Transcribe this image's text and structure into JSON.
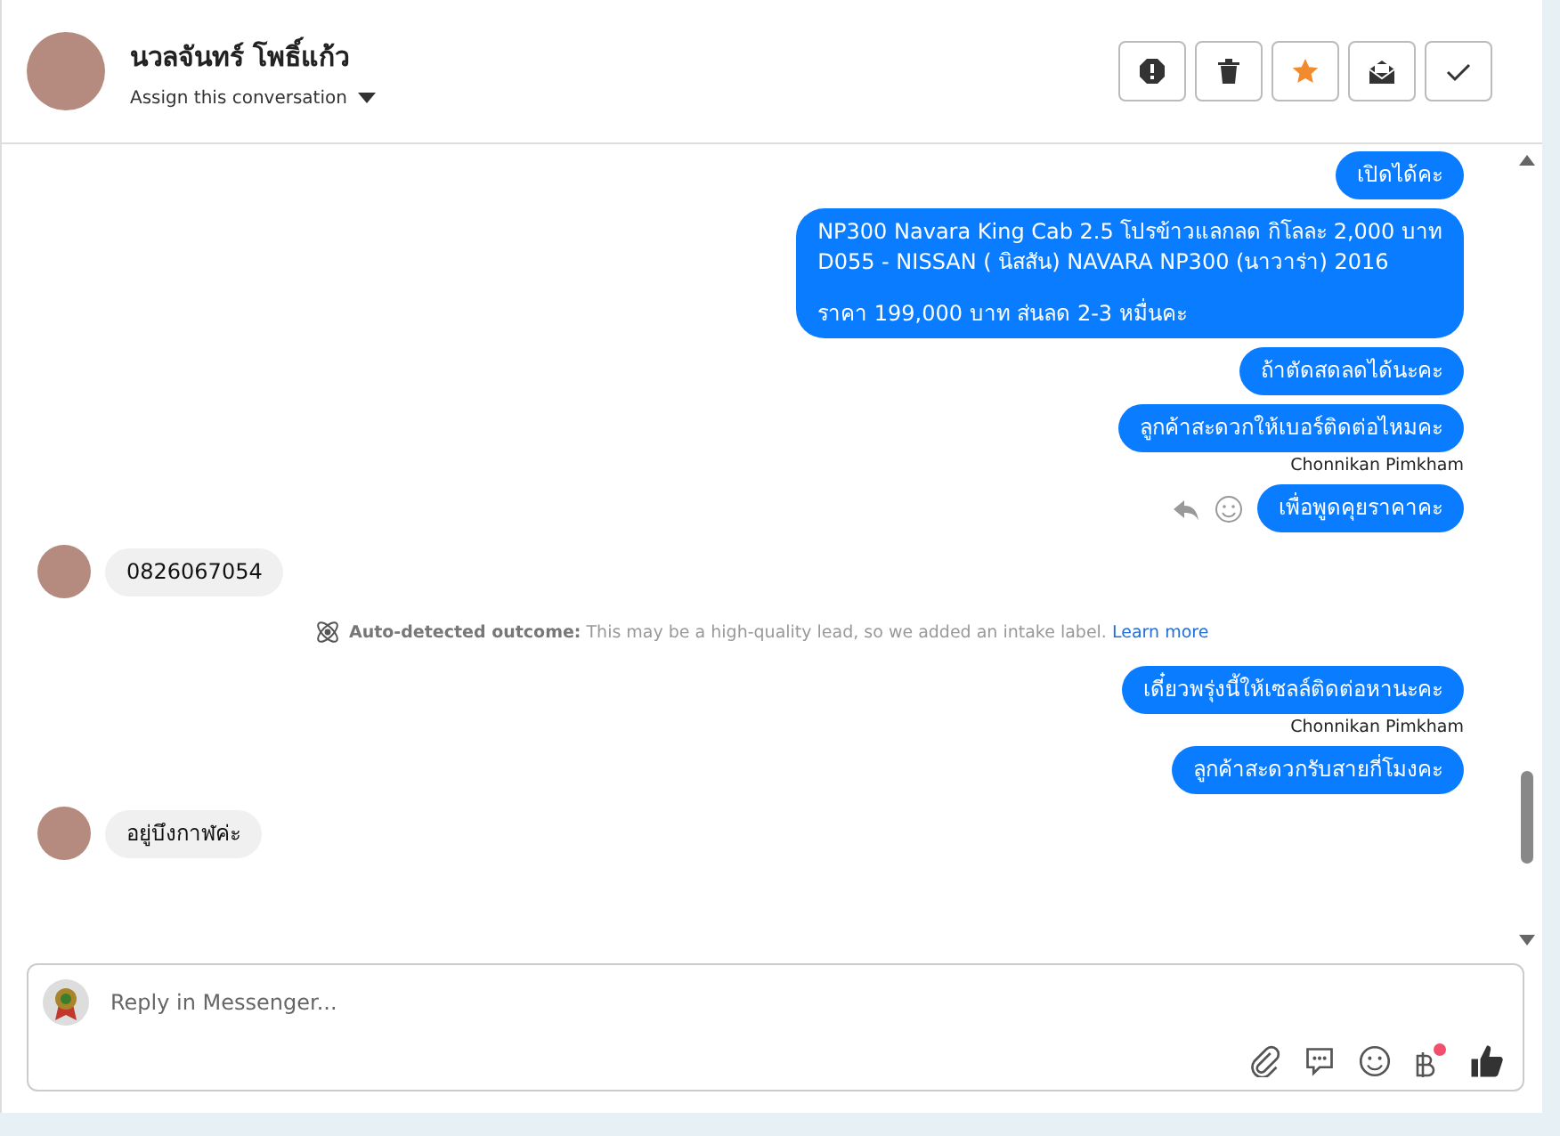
{
  "header": {
    "name": "นวลจันทร์ โพธิ์แก้ว",
    "assign": "Assign this conversation"
  },
  "messages": [
    {
      "kind": "out",
      "lines": [
        "เปิดได้คะ"
      ]
    },
    {
      "kind": "out",
      "lines": [
        "NP300 Navara King Cab 2.5 โปรข้าวแลกลด กิโลละ 2,000 บาท",
        "D055 - NISSAN ( นิสสัน) NAVARA NP300 (นาวาร่า) 2016"
      ],
      "after_break": [
        "ราคา 199,000 บาท ส่นลด 2-3 หมื่นคะ"
      ]
    },
    {
      "kind": "out",
      "lines": [
        "ถ้าตัดสดลดได้นะคะ"
      ]
    },
    {
      "kind": "out",
      "lines": [
        "ลูกค้าสะดวกให้เบอร์ติดต่อไหมคะ"
      ],
      "sender": "Chonnikan Pimkham"
    },
    {
      "kind": "out",
      "lines": [
        "เพื่อพูดคุยราคาคะ"
      ],
      "actions": true
    },
    {
      "kind": "in",
      "lines": [
        "0826067054"
      ]
    },
    {
      "kind": "notice",
      "label": "Auto-detected outcome:",
      "text": "This may be a high-quality lead, so we added an intake label.",
      "link": "Learn more"
    },
    {
      "kind": "out",
      "lines": [
        "เดี๋ยวพรุ่งนี้ให้เซลล์ติดต่อหานะคะ"
      ],
      "sender": "Chonnikan Pimkham"
    },
    {
      "kind": "out",
      "lines": [
        "ลูกค้าสะดวกรับสายกี่โมงคะ"
      ]
    },
    {
      "kind": "in",
      "lines": [
        "อยู่บึงกาฬค่ะ"
      ]
    }
  ],
  "composer": {
    "placeholder": "Reply in Messenger..."
  }
}
